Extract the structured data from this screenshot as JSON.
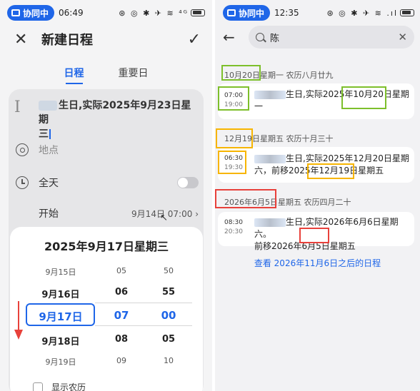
{
  "left": {
    "status": {
      "badge": "协同中",
      "time": "06:49",
      "icons": "⊛ ◎ ✱ ✈ ≋ ⁴ᴳ"
    },
    "header": {
      "title": "新建日程"
    },
    "tabs": [
      {
        "label": "日程",
        "active": true
      },
      {
        "label": "重要日",
        "active": false
      }
    ],
    "event_title": {
      "visible": "生日,实际2025年9月23日星期",
      "line2": "三"
    },
    "location_placeholder": "地点",
    "all_day_label": "全天",
    "start": {
      "label": "开始",
      "value": "9月14日 07:00",
      "chevron": "›"
    },
    "picker": {
      "title": "2025年9月17日星期三",
      "dates": [
        "9月15日",
        "9月16日",
        "9月17日",
        "9月18日",
        "9月19日"
      ],
      "hours": [
        "05",
        "06",
        "07",
        "08",
        "09"
      ],
      "minutes": [
        "50",
        "55",
        "00",
        "05",
        "10"
      ],
      "selected_index": 2
    },
    "show_lunar_label": "显示农历"
  },
  "right": {
    "status": {
      "badge": "协同中",
      "time": "12:35",
      "icons": "⊛ ◎ ✱ ✈ ≋ .ıl"
    },
    "search": {
      "query": "陈"
    },
    "sections": [
      {
        "header": "10月20日星期一 农历八月廿九",
        "start": "07:00",
        "end": "19:00",
        "line1": "生日,实际2025年10月20日星期",
        "line2": "一"
      },
      {
        "header": "12月19日星期五 农历十月三十",
        "start": "06:30",
        "end": "19:30",
        "line1": "生日,实际2025年12月20日星期",
        "line2": "六，前移2025年12月19日星期五"
      },
      {
        "header": "2026年6月5日星期五 农历四月二十",
        "start": "08:30",
        "end": "20:30",
        "line1": "生日,实际2026年6月6日星期六。",
        "line2": "前移2026年6月5日星期五"
      }
    ],
    "view_more": "查看 2026年11月6日之后的日程"
  },
  "colors": {
    "accent": "#1f66e8",
    "green_box": "#7dbf2b",
    "yellow_box": "#f7b500",
    "red_box": "#e8413b"
  }
}
